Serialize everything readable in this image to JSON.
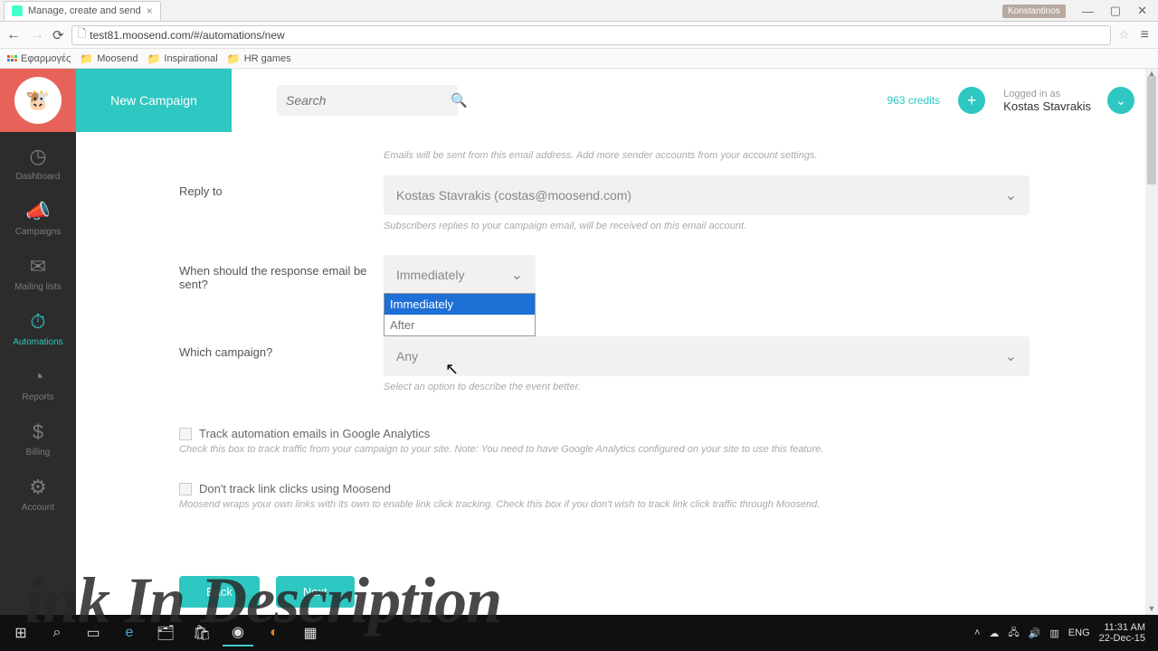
{
  "browser": {
    "tab_title": "Manage, create and send",
    "url": "test81.moosend.com/#/automations/new",
    "user_badge": "Konstantinos",
    "bookmarks": {
      "apps": "Εφαρμογές",
      "b1": "Moosend",
      "b2": "Inspirational",
      "b3": "HR games"
    }
  },
  "sidebar": {
    "items": [
      {
        "icon": "◷",
        "label": "Dashboard"
      },
      {
        "icon": "📣",
        "label": "Campaigns"
      },
      {
        "icon": "✉",
        "label": "Mailing lists"
      },
      {
        "icon": "⏱",
        "label": "Automations"
      },
      {
        "icon": "◔",
        "label": "Reports"
      },
      {
        "icon": "$",
        "label": "Billing"
      },
      {
        "icon": "⚙",
        "label": "Account"
      }
    ]
  },
  "topbar": {
    "new_campaign": "New Campaign",
    "search_placeholder": "Search",
    "credits": "963 credits",
    "logged_in_as": "Logged in as",
    "user_name": "Kostas Stavrakis"
  },
  "form": {
    "sender_help": "Emails will be sent from this email address. Add more sender accounts from your account settings.",
    "reply_to_label": "Reply to",
    "reply_to_value": "Kostas Stavrakis (costas@moosend.com)",
    "reply_to_help": "Subscribers replies to your campaign email, will be received on this email account.",
    "when_label": "When should the response email be sent?",
    "when_value": "Immediately",
    "when_options": {
      "opt1": "Immediately",
      "opt2": "After"
    },
    "campaign_label": "Which campaign?",
    "campaign_value": "Any",
    "campaign_help": "Select an option to describe the event better.",
    "ga_label": "Track automation emails in Google Analytics",
    "ga_help": "Check this box to track traffic from your campaign to your site. Note: You need to have Google Analytics configured on your site to use this feature.",
    "dont_track_label": "Don't track link clicks using Moosend",
    "dont_track_help": "Moosend wraps your own links with its own to enable link click tracking. Check this box if you don't wish to track link click traffic through Moosend.",
    "back_btn": "Back",
    "next_btn": "Next"
  },
  "watermark": "ink In Description",
  "taskbar": {
    "lang": "ENG",
    "time": "11:31 AM",
    "date": "22-Dec-15"
  }
}
